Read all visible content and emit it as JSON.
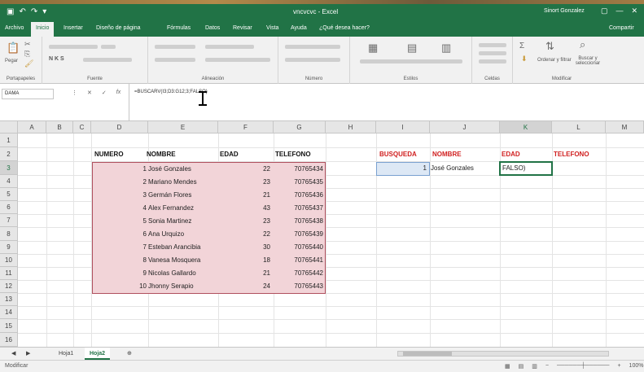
{
  "titlebar": {
    "title": "vncvcvc - Excel",
    "user": "Sinort Gonzalez",
    "win": [
      "▢",
      "—",
      "✕"
    ]
  },
  "tabs": [
    {
      "label": "Archivo",
      "active": false
    },
    {
      "label": "Inicio",
      "active": true
    },
    {
      "label": "Insertar",
      "active": false
    },
    {
      "label": "Diseño de página",
      "active": false
    },
    {
      "label": "Fórmulas",
      "active": false
    },
    {
      "label": "Datos",
      "active": false
    },
    {
      "label": "Revisar",
      "active": false
    },
    {
      "label": "Vista",
      "active": false
    },
    {
      "label": "Ayuda",
      "active": false
    },
    {
      "label": "¿Qué desea hacer?",
      "active": false
    },
    {
      "label": "Compartir",
      "active": false
    }
  ],
  "ribbon": {
    "groups": [
      "Portapapeles",
      "Fuente",
      "Alineación",
      "Número",
      "Estilos",
      "Celdas",
      "Modificar"
    ],
    "paste": "Pegar",
    "find": "Buscar y seleccionar",
    "sort": "Ordenar y filtrar"
  },
  "formula_bar": {
    "name_box": "DAMA",
    "formula": "=BUSCARV(I3;D3:G12;3;FALSO)"
  },
  "columns": [
    "A",
    "B",
    "C",
    "D",
    "E",
    "F",
    "G",
    "H",
    "I",
    "J",
    "K",
    "L",
    "M"
  ],
  "rows": [
    "1",
    "2",
    "3",
    "4",
    "5",
    "6",
    "7",
    "8",
    "9",
    "10",
    "11",
    "12",
    "13",
    "14",
    "15",
    "16"
  ],
  "table": {
    "headers": {
      "numero": "NUMERO",
      "nombre": "NOMBRE",
      "edad": "EDAD",
      "telefono": "TELEFONO"
    },
    "records": [
      {
        "numero": "1",
        "nombre": "José Gonzales",
        "edad": "22",
        "telefono": "70765434"
      },
      {
        "numero": "2",
        "nombre": "Mariano Mendes",
        "edad": "23",
        "telefono": "70765435"
      },
      {
        "numero": "3",
        "nombre": "Germán Flores",
        "edad": "21",
        "telefono": "70765436"
      },
      {
        "numero": "4",
        "nombre": "Alex Fernandez",
        "edad": "43",
        "telefono": "70765437"
      },
      {
        "numero": "5",
        "nombre": "Sonia Martinez",
        "edad": "23",
        "telefono": "70765438"
      },
      {
        "numero": "6",
        "nombre": "Ana Urquizo",
        "edad": "22",
        "telefono": "70765439"
      },
      {
        "numero": "7",
        "nombre": "Esteban Arancibia",
        "edad": "30",
        "telefono": "70765440"
      },
      {
        "numero": "8",
        "nombre": "Vanesa Mosquera",
        "edad": "18",
        "telefono": "70765441"
      },
      {
        "numero": "9",
        "nombre": "Nicolas Gallardo",
        "edad": "21",
        "telefono": "70765442"
      },
      {
        "numero": "10",
        "nombre": "Jhonny Serapio",
        "edad": "24",
        "telefono": "70765443"
      }
    ]
  },
  "lookup": {
    "headers": {
      "busqueda": "BUSQUEDA",
      "nombre": "NOMBRE",
      "edad": "EDAD",
      "telefono": "TELEFONO"
    },
    "busqueda_value": "1",
    "nombre_value": "José Gonzales",
    "edad_value": "FALSO)"
  },
  "sheets": [
    {
      "label": "Hoja1",
      "active": false
    },
    {
      "label": "Hoja2",
      "active": true
    }
  ],
  "status": {
    "text": "Modificar",
    "zoom": "100%"
  },
  "colors": {
    "excel_green": "#217346",
    "header_red": "#d01f1f",
    "range_pink": "#f2d4d8"
  }
}
